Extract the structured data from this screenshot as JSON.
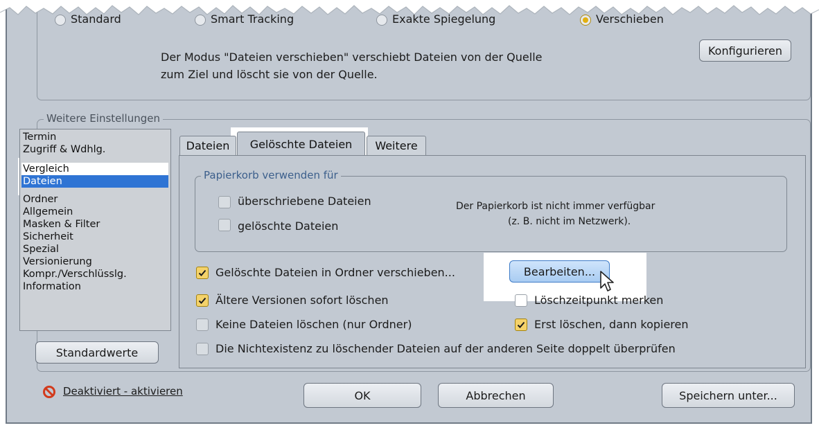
{
  "mode": {
    "radio_options": [
      "Standard",
      "Smart Tracking",
      "Exakte Spiegelung",
      "Verschieben"
    ],
    "selected_index": 3,
    "description_line1": "Der Modus \"Dateien verschieben\" verschiebt Dateien von der Quelle",
    "description_line2": "zum Ziel und löscht sie von der Quelle.",
    "configure_label": "Konfigurieren"
  },
  "weitere": {
    "group_title": "Weitere Einstellungen",
    "list_items": [
      "Termin",
      "Zugriff & Wdhlg.",
      "Vergleich",
      "Dateien",
      "Ordner",
      "Allgemein",
      "Masken & Filter",
      "Sicherheit",
      "Spezial",
      "Versionierung",
      "Kompr./Verschlüsslg.",
      "Information"
    ],
    "selected_item": "Dateien",
    "defaults_button": "Standardwerte"
  },
  "tabs": {
    "labels": [
      "Dateien",
      "Gelöschte Dateien",
      "Weitere"
    ],
    "active": "Gelöschte Dateien"
  },
  "recycle": {
    "group_title": "Papierkorb verwenden für",
    "overwritten_label": "überschriebene Dateien",
    "deleted_label": "gelöschte Dateien",
    "overwritten_checked": false,
    "deleted_checked": false,
    "note_line1": "Der Papierkorb ist nicht immer verfügbar",
    "note_line2": "(z. B. nicht im Netzwerk)."
  },
  "options": {
    "move_deleted_label": "Gelöschte Dateien in Ordner verschieben...",
    "move_deleted_checked": true,
    "edit_button": "Bearbeiten...",
    "delete_older_label": "Ältere Versionen sofort löschen",
    "delete_older_checked": true,
    "remember_time_label": "Löschzeitpunkt merken",
    "remember_time_checked": false,
    "no_delete_label": "Keine Dateien löschen (nur Ordner)",
    "no_delete_checked": false,
    "delete_first_label": "Erst löschen, dann kopieren",
    "delete_first_checked": true,
    "double_check_label": "Die Nichtexistenz zu löschender Dateien auf der anderen Seite doppelt überprüfen",
    "double_check_checked": false
  },
  "footer": {
    "deactivated_link": "Deaktiviert - aktivieren",
    "ok_label": "OK",
    "cancel_label": "Abbrechen",
    "save_as_label": "Speichern unter..."
  },
  "colors": {
    "window_bg": "#c2c9d2",
    "selection_blue": "#2f74d4",
    "checkmark_bg": "#f4d26a",
    "radio_selected": "#e2b010",
    "edit_button_bg": "#b9d6f5"
  }
}
